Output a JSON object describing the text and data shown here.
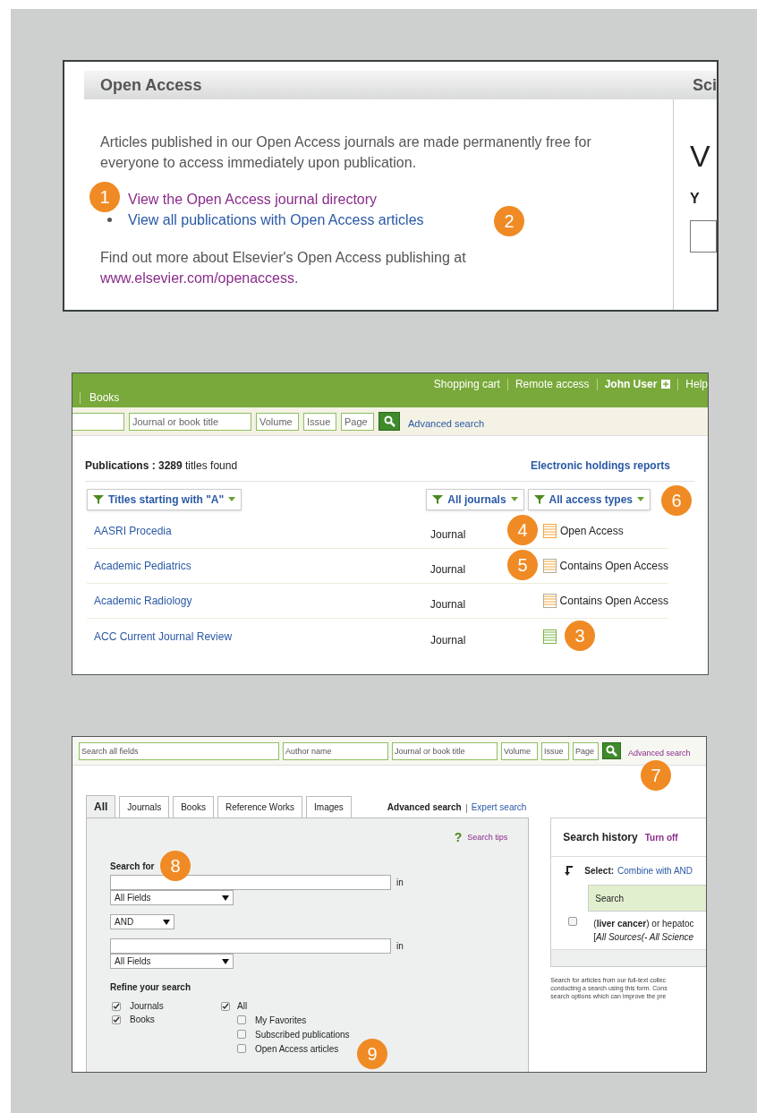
{
  "panel_open_access": {
    "title": "Open Access",
    "header_right": "Sci",
    "intro": "Articles published in our Open Access journals are made permanently free for everyone to access immediately upon publication.",
    "links": [
      {
        "text": "View the Open Access journal directory",
        "visited": true,
        "callout": "1"
      },
      {
        "text": "View all publications with Open Access articles",
        "visited": false,
        "callout": "2"
      }
    ],
    "footer_text": "Find out more about Elsevier's Open Access publishing at",
    "footer_link": "www.elsevier.com/openaccess",
    "footer_end": ".",
    "side_heading": "V",
    "side_label": "Y"
  },
  "panel_publications": {
    "nav_left": "Books",
    "nav_right": [
      "Shopping cart",
      "Remote access",
      "John User",
      "Help"
    ],
    "search_fields": [
      {
        "placeholder": "Journal or book title"
      },
      {
        "placeholder": "Volume"
      },
      {
        "placeholder": "Issue"
      },
      {
        "placeholder": "Page"
      }
    ],
    "advanced_search": "Advanced search",
    "count": "**Publications : 3289** titles found",
    "holdings_link": "Electronic holdings reports",
    "filters_left": "Titles starting with \"A\"",
    "filters_right": [
      "All journals",
      "All access types"
    ],
    "filters_callout": "6",
    "rows": [
      {
        "title": "AASRI Procedia",
        "type": "Journal",
        "kind": "open",
        "access_label": "Open Access",
        "callout": "4"
      },
      {
        "title": "Academic Pediatrics",
        "type": "Journal",
        "kind": "contains",
        "access_label": "Contains Open Access",
        "callout": "5"
      },
      {
        "title": "Academic Radiology",
        "type": "Journal",
        "kind": "contains",
        "access_label": "Contains Open Access"
      },
      {
        "title": "ACC Current Journal Review",
        "type": "Journal",
        "kind": "none",
        "callout": "3"
      }
    ]
  },
  "panel_search": {
    "search_fields": [
      {
        "placeholder": "Search all fields"
      },
      {
        "placeholder": "Author name"
      },
      {
        "placeholder": "Journal or book title"
      },
      {
        "placeholder": "Volume"
      },
      {
        "placeholder": "Issue"
      },
      {
        "placeholder": "Page"
      }
    ],
    "advanced_search": "Advanced search",
    "advanced_callout": "7",
    "tabs": [
      {
        "label": "All",
        "selected": true
      },
      {
        "label": "Journals",
        "selected": false
      },
      {
        "label": "Books",
        "selected": false
      },
      {
        "label": "Reference Works",
        "selected": false
      },
      {
        "label": "Images",
        "selected": false
      }
    ],
    "mode_current": "Advanced search",
    "mode_other": "Expert search",
    "tips": "Search tips",
    "tips_icon": "?",
    "search_for": "Search for",
    "search_for_callout": "8",
    "in_label_1": "in",
    "in_label_2": "in",
    "field_select_1": "All Fields",
    "operator": "AND",
    "field_select_2": "All Fields",
    "refine_title": "Refine your search",
    "refine_callout": "9",
    "content_types": [
      {
        "label": "Journals",
        "checked": true
      },
      {
        "label": "Books",
        "checked": true
      }
    ],
    "sources": {
      "label": "All",
      "checked": true,
      "children": [
        {
          "label": "My Favorites",
          "checked": false
        },
        {
          "label": "Subscribed publications",
          "checked": false
        },
        {
          "label": "Open Access articles",
          "checked": false
        }
      ]
    },
    "history": {
      "title": "Search history",
      "toggle": "Turn off",
      "select_label": "Select:",
      "combine": "Combine with AND",
      "column": "Search",
      "rows": [
        {
          "checked": false,
          "query": "(**liver cancer**) or hepatoc",
          "source": "[*All Sources(- All Science*"
        }
      ]
    },
    "note_lines": [
      "Search for articles from our full-text collec",
      "conducting a search using this form. Cons",
      "search options which can improve the pre"
    ]
  }
}
